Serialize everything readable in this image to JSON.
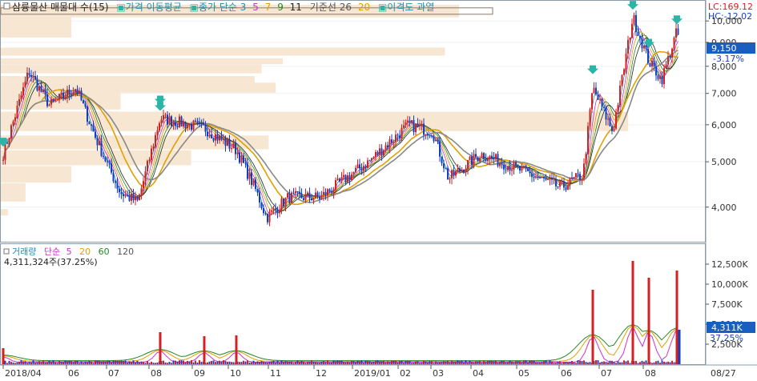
{
  "price_panel": {
    "legend": [
      {
        "text": "삼륭물산 매물대 수(15)",
        "color": "#222222"
      },
      {
        "text": "가격 이동평균",
        "color": "#1a8fb0"
      },
      {
        "text": "종가 단순 3",
        "color": "#1a8fb0"
      },
      {
        "text": "5",
        "color": "#cc33cc"
      },
      {
        "text": "7",
        "color": "#e0a000"
      },
      {
        "text": "9",
        "color": "#228822"
      },
      {
        "text": "11",
        "color": "#222222"
      },
      {
        "text": "기준선 26",
        "color": "#555555"
      },
      {
        "text": "20",
        "color": "#e0a000"
      },
      {
        "text": "이격도 과열",
        "color": "#1a8fb0"
      }
    ],
    "lc_label": "LC:169.12",
    "hc_label": "HC:-12.02",
    "current_price": "9,150",
    "current_change": "-3.17%",
    "y_ticks": [
      "10,000",
      "9,000",
      "8,000",
      "7,000",
      "6,000",
      "5,000",
      "4,000"
    ]
  },
  "volume_panel": {
    "legend": [
      {
        "text": "거래량",
        "color": "#1a8fb0"
      },
      {
        "text": "단순",
        "color": "#cc33cc"
      },
      {
        "text": "5",
        "color": "#cc33cc"
      },
      {
        "text": "20",
        "color": "#e0a000"
      },
      {
        "text": "60",
        "color": "#228822"
      },
      {
        "text": "120",
        "color": "#555555"
      }
    ],
    "current_volume_text": "4,311,324주(37.25%)",
    "current_volume": "4,311K",
    "current_pct": "37.25%",
    "y_ticks": [
      "12,500K",
      "10,000K",
      "7,500K",
      "5,000K",
      "2,500K"
    ]
  },
  "x_ticks": [
    "2018/04",
    "06",
    "07",
    "08",
    "09",
    "10",
    "11",
    "12",
    "2019/01",
    "02",
    "03",
    "04",
    "05",
    "06",
    "07",
    "08",
    "08/27"
  ],
  "colors": {
    "up": "#d42020",
    "down": "#1040c0",
    "volume_profile": "#f7e6d2",
    "arrow": "#2bb5a6",
    "ma3": "#1a8fb0",
    "ma5": "#cc33cc",
    "ma7": "#e0a000",
    "ma9": "#228822",
    "ma11": "#222222",
    "kijun26": "#888888",
    "ma20": "#e0a000",
    "axis_highlight": "#1a5fc0"
  },
  "chart_data": {
    "type": "candlestick",
    "price_axis": {
      "scale": "log",
      "range": [
        3400,
        11000
      ]
    },
    "volume_axis": {
      "range": [
        0,
        13500000
      ]
    },
    "price_path": [
      {
        "x": "2018/04",
        "price": 5200
      },
      {
        "x": "2018/04 mid",
        "price": 7800
      },
      {
        "x": "2018/05",
        "price": 6600
      },
      {
        "x": "2018/06",
        "price": 7200
      },
      {
        "x": "2018/06 late",
        "price": 5600
      },
      {
        "x": "2018/07",
        "price": 4300
      },
      {
        "x": "2018/07 late",
        "price": 4100
      },
      {
        "x": "2018/08",
        "price": 6200
      },
      {
        "x": "2018/09",
        "price": 5900
      },
      {
        "x": "2018/10",
        "price": 5300
      },
      {
        "x": "2018/10 late",
        "price": 4400
      },
      {
        "x": "2018/11",
        "price": 3800
      },
      {
        "x": "2018/11 mid",
        "price": 4200
      },
      {
        "x": "2018/12",
        "price": 4200
      },
      {
        "x": "2019/01",
        "price": 5000
      },
      {
        "x": "2019/02",
        "price": 6000
      },
      {
        "x": "2019/03",
        "price": 5800
      },
      {
        "x": "2019/03 mid",
        "price": 4600
      },
      {
        "x": "2019/04",
        "price": 5200
      },
      {
        "x": "2019/05",
        "price": 4800
      },
      {
        "x": "2019/06",
        "price": 4400
      },
      {
        "x": "2019/06 late",
        "price": 4700
      },
      {
        "x": "2019/07",
        "price": 7200
      },
      {
        "x": "2019/07 mid",
        "price": 5800
      },
      {
        "x": "2019/07 late",
        "price": 10200
      },
      {
        "x": "2019/08",
        "price": 8200
      },
      {
        "x": "2019/08 mid",
        "price": 7500
      },
      {
        "x": "2019/08 late",
        "price": 9500
      },
      {
        "x": "2019/08/27",
        "price": 9150
      }
    ],
    "volume_profile": [
      {
        "price": 10500,
        "relative_volume": 0.65
      },
      {
        "price": 9800,
        "relative_volume": 0.1
      },
      {
        "price": 8600,
        "relative_volume": 0.63
      },
      {
        "price": 8200,
        "relative_volume": 0.4
      },
      {
        "price": 7900,
        "relative_volume": 0.37
      },
      {
        "price": 7500,
        "relative_volume": 0.36
      },
      {
        "price": 7200,
        "relative_volume": 0.39
      },
      {
        "price": 6800,
        "relative_volume": 0.17
      },
      {
        "price": 6100,
        "relative_volume": 0.89
      },
      {
        "price": 5500,
        "relative_volume": 0.38
      },
      {
        "price": 5100,
        "relative_volume": 0.27
      },
      {
        "price": 4700,
        "relative_volume": 0.1
      },
      {
        "price": 4300,
        "relative_volume": 0.035
      },
      {
        "price": 3900,
        "relative_volume": 0.01
      }
    ],
    "volume_spikes": [
      {
        "x": "2018/08",
        "volume": 4000000
      },
      {
        "x": "2018/08 mid",
        "volume": 2000000
      },
      {
        "x": "2018/09",
        "volume": 3500000
      },
      {
        "x": "2018/10",
        "volume": 3600000
      },
      {
        "x": "2019/07",
        "volume": 9300000
      },
      {
        "x": "2019/07 late",
        "volume": 12900000
      },
      {
        "x": "2019/08",
        "volume": 10800000
      },
      {
        "x": "2019/08 late",
        "volume": 11700000
      },
      {
        "x": "2019/08/27",
        "volume": 4311324
      }
    ],
    "arrow_signals": [
      "2018/04",
      "2018/08",
      "2018/08",
      "2019/07",
      "2019/07 late",
      "2019/08",
      "2019/08 late"
    ]
  }
}
